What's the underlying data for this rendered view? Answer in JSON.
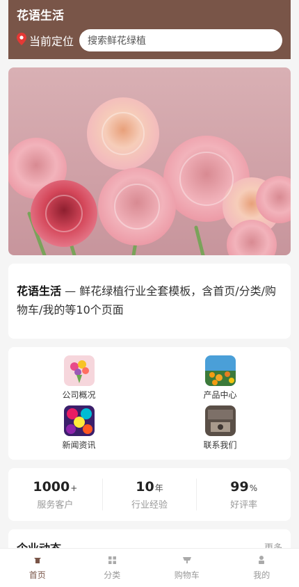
{
  "header": {
    "title": "花语生活",
    "location_label": "当前定位",
    "search_placeholder": "搜索鲜花绿植"
  },
  "intro": {
    "brand": "花语生活",
    "text": " — 鲜花绿植行业全套模板，含首页/分类/购物车/我的等10个页面"
  },
  "grid": [
    {
      "label": "公司概况",
      "icon": "bouquet-icon"
    },
    {
      "label": "产品中心",
      "icon": "flower-field-icon"
    },
    {
      "label": "新闻资讯",
      "icon": "colorful-flowers-icon"
    },
    {
      "label": "联系我们",
      "icon": "contact-photo-icon"
    }
  ],
  "stats": [
    {
      "value": "1000",
      "unit": "+",
      "label": "服务客户"
    },
    {
      "value": "10",
      "unit": "年",
      "label": "行业经验"
    },
    {
      "value": "99",
      "unit": "%",
      "label": "好评率"
    }
  ],
  "news": {
    "title": "企业动态",
    "more": "更多"
  },
  "tabbar": [
    {
      "label": "首页",
      "icon": "home-icon",
      "active": true
    },
    {
      "label": "分类",
      "icon": "category-icon",
      "active": false
    },
    {
      "label": "购物车",
      "icon": "cart-icon",
      "active": false
    },
    {
      "label": "我的",
      "icon": "user-icon",
      "active": false
    }
  ],
  "colors": {
    "accent": "#795548",
    "background": "#f5f5f5",
    "muted": "#999999"
  }
}
